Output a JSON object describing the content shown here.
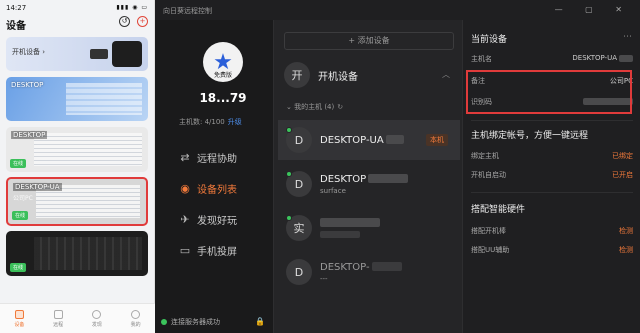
{
  "phone": {
    "time": "14:27",
    "status_icons": "▮▮▮ ◉ ▭",
    "title": "设备",
    "cards": [
      {
        "name": "开机设备 ›",
        "sub": "",
        "badge": ""
      },
      {
        "name": "DESKTOP",
        "sub": "",
        "badge": ""
      },
      {
        "name": "DESKTOP",
        "sub": "",
        "badge": "在线"
      },
      {
        "name": "DESKTOP-UA",
        "sub": "公司PC",
        "badge": "在线"
      },
      {
        "name": "",
        "sub": "",
        "badge": "在线"
      }
    ],
    "nav": [
      "设备",
      "远程",
      "发现",
      "我的"
    ]
  },
  "app": {
    "title": "向日葵远程控制",
    "window_buttons": "— ▢ ✕",
    "sidebar": {
      "level": "免费版",
      "user_id": "18...79",
      "hosts_label": "主机数: 4/100",
      "upgrade_label": "升级",
      "menu": [
        {
          "icon": "⇄",
          "label": "远程协助"
        },
        {
          "icon": "◉",
          "label": "设备列表"
        },
        {
          "icon": "✈",
          "label": "发现好玩"
        },
        {
          "icon": "▭",
          "label": "手机投屏"
        }
      ],
      "connection": "连接服务器成功",
      "lock_icon": "🔒"
    },
    "devices": {
      "add_label": "+ 添加设备",
      "group_letter": "开",
      "group_name": "开机设备",
      "section_label": "我的主机 (4)",
      "refresh": "↻",
      "list": [
        {
          "letter": "D",
          "name": "DESKTOP-UA",
          "sub": "",
          "tag": "本机"
        },
        {
          "letter": "D",
          "name": "DESKTOP",
          "sub": "surface",
          "tag": ""
        },
        {
          "letter": "实",
          "name": "",
          "sub": "",
          "tag": ""
        },
        {
          "letter": "D",
          "name": "DESKTOP-",
          "sub": "---",
          "tag": ""
        }
      ]
    },
    "detail": {
      "current_title": "当前设备",
      "host_label": "主机名",
      "host_value": "DESKTOP-UA",
      "remark_label": "备注",
      "remark_value": "公司PC",
      "code_label": "识别码",
      "bind_title": "主机绑定帐号，方便一键远程",
      "bind_label": "绑定主机",
      "bind_value": "已绑定",
      "boot_label": "开机自启动",
      "boot_value": "已开启",
      "hw_title": "搭配智能硬件",
      "hw1_label": "搭配开机棒",
      "hw1_value": "检测",
      "hw2_label": "搭配UU辅助",
      "hw2_value": "检测"
    }
  }
}
